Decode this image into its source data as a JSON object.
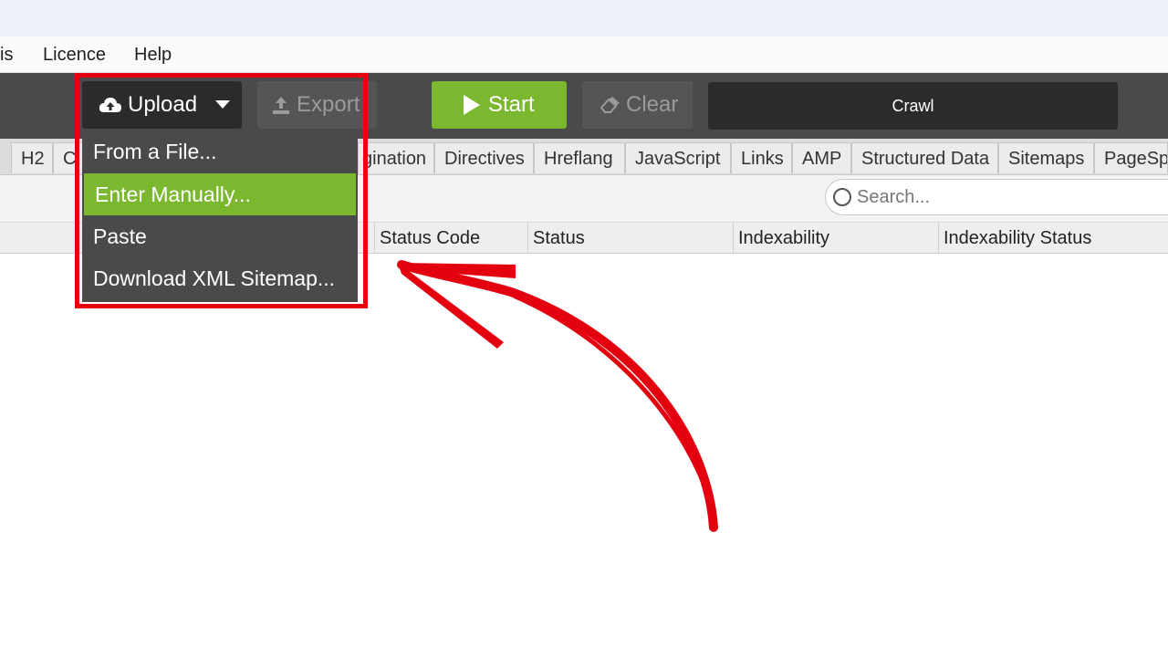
{
  "menu": {
    "items": [
      "is",
      "Licence",
      "Help"
    ]
  },
  "toolbar": {
    "upload_label": "Upload",
    "export_label": "Export",
    "start_label": "Start",
    "clear_label": "Clear",
    "crawl_value": "Crawl"
  },
  "tabs": [
    "H2",
    "C",
    "gination",
    "Directives",
    "Hreflang",
    "JavaScript",
    "Links",
    "AMP",
    "Structured Data",
    "Sitemaps",
    "PageSp"
  ],
  "search": {
    "placeholder": "Search..."
  },
  "columns": [
    "Status Code",
    "Status",
    "Indexability",
    "Indexability Status"
  ],
  "upload_menu": {
    "items": [
      "From a File...",
      "Enter Manually...",
      "Paste",
      "Download XML Sitemap..."
    ],
    "highlighted_item": "Enter Manually..."
  },
  "colors": {
    "accent_green": "#7cb82f",
    "highlight_red": "#e3000f",
    "toolbar_dark": "#4a4a4a"
  },
  "icons": [
    "cloud-upload-icon",
    "caret-down-icon",
    "export-icon",
    "play-icon",
    "eraser-icon",
    "search-icon"
  ]
}
